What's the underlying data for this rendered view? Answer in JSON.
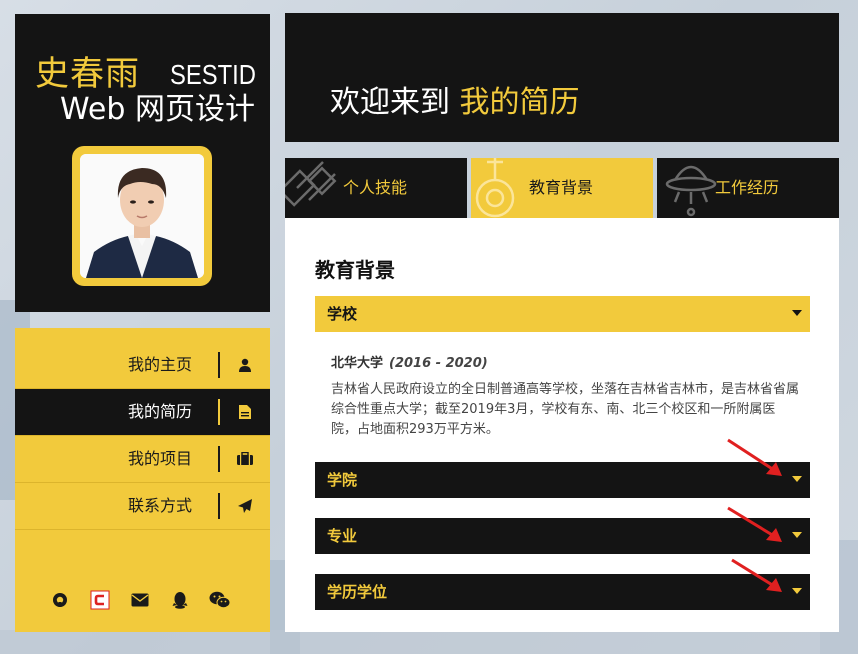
{
  "profile": {
    "name_cn": "史春雨",
    "name_en": "SESTID",
    "subtitle": "Web 网页设计"
  },
  "nav": {
    "items": [
      {
        "label": "我的主页",
        "icon": "user-icon",
        "active": false
      },
      {
        "label": "我的简历",
        "icon": "document-icon",
        "active": true
      },
      {
        "label": "我的项目",
        "icon": "briefcase-icon",
        "active": false
      },
      {
        "label": "联系方式",
        "icon": "paper-plane-icon",
        "active": false
      }
    ],
    "social": [
      "github-icon",
      "csdn-icon",
      "email-icon",
      "qq-icon",
      "wechat-icon"
    ]
  },
  "banner": {
    "prefix": "欢迎来到 ",
    "highlight": "我的简历"
  },
  "tabs": [
    {
      "label": "个人技能",
      "icon": "satellite-icon",
      "active": false
    },
    {
      "label": "教育背景",
      "icon": "joystick-icon",
      "active": true
    },
    {
      "label": "工作经历",
      "icon": "ufo-icon",
      "active": false
    }
  ],
  "panel": {
    "title": "教育背景",
    "accordions": [
      {
        "label": "学校",
        "open": true
      },
      {
        "label": "学院",
        "open": false
      },
      {
        "label": "专业",
        "open": false
      },
      {
        "label": "学历学位",
        "open": false
      }
    ],
    "school_name": "北华大学",
    "school_years": "(2016 - 2020)",
    "school_desc": "吉林省人民政府设立的全日制普通高等学校，坐落在吉林省吉林市，是吉林省省属综合性重点大学；截至2019年3月，学校有东、南、北三个校区和一所附属医院，占地面积293万平方米。"
  },
  "colors": {
    "accent": "#f2ca3c",
    "dark": "#141414",
    "annotation": "#e02020"
  }
}
